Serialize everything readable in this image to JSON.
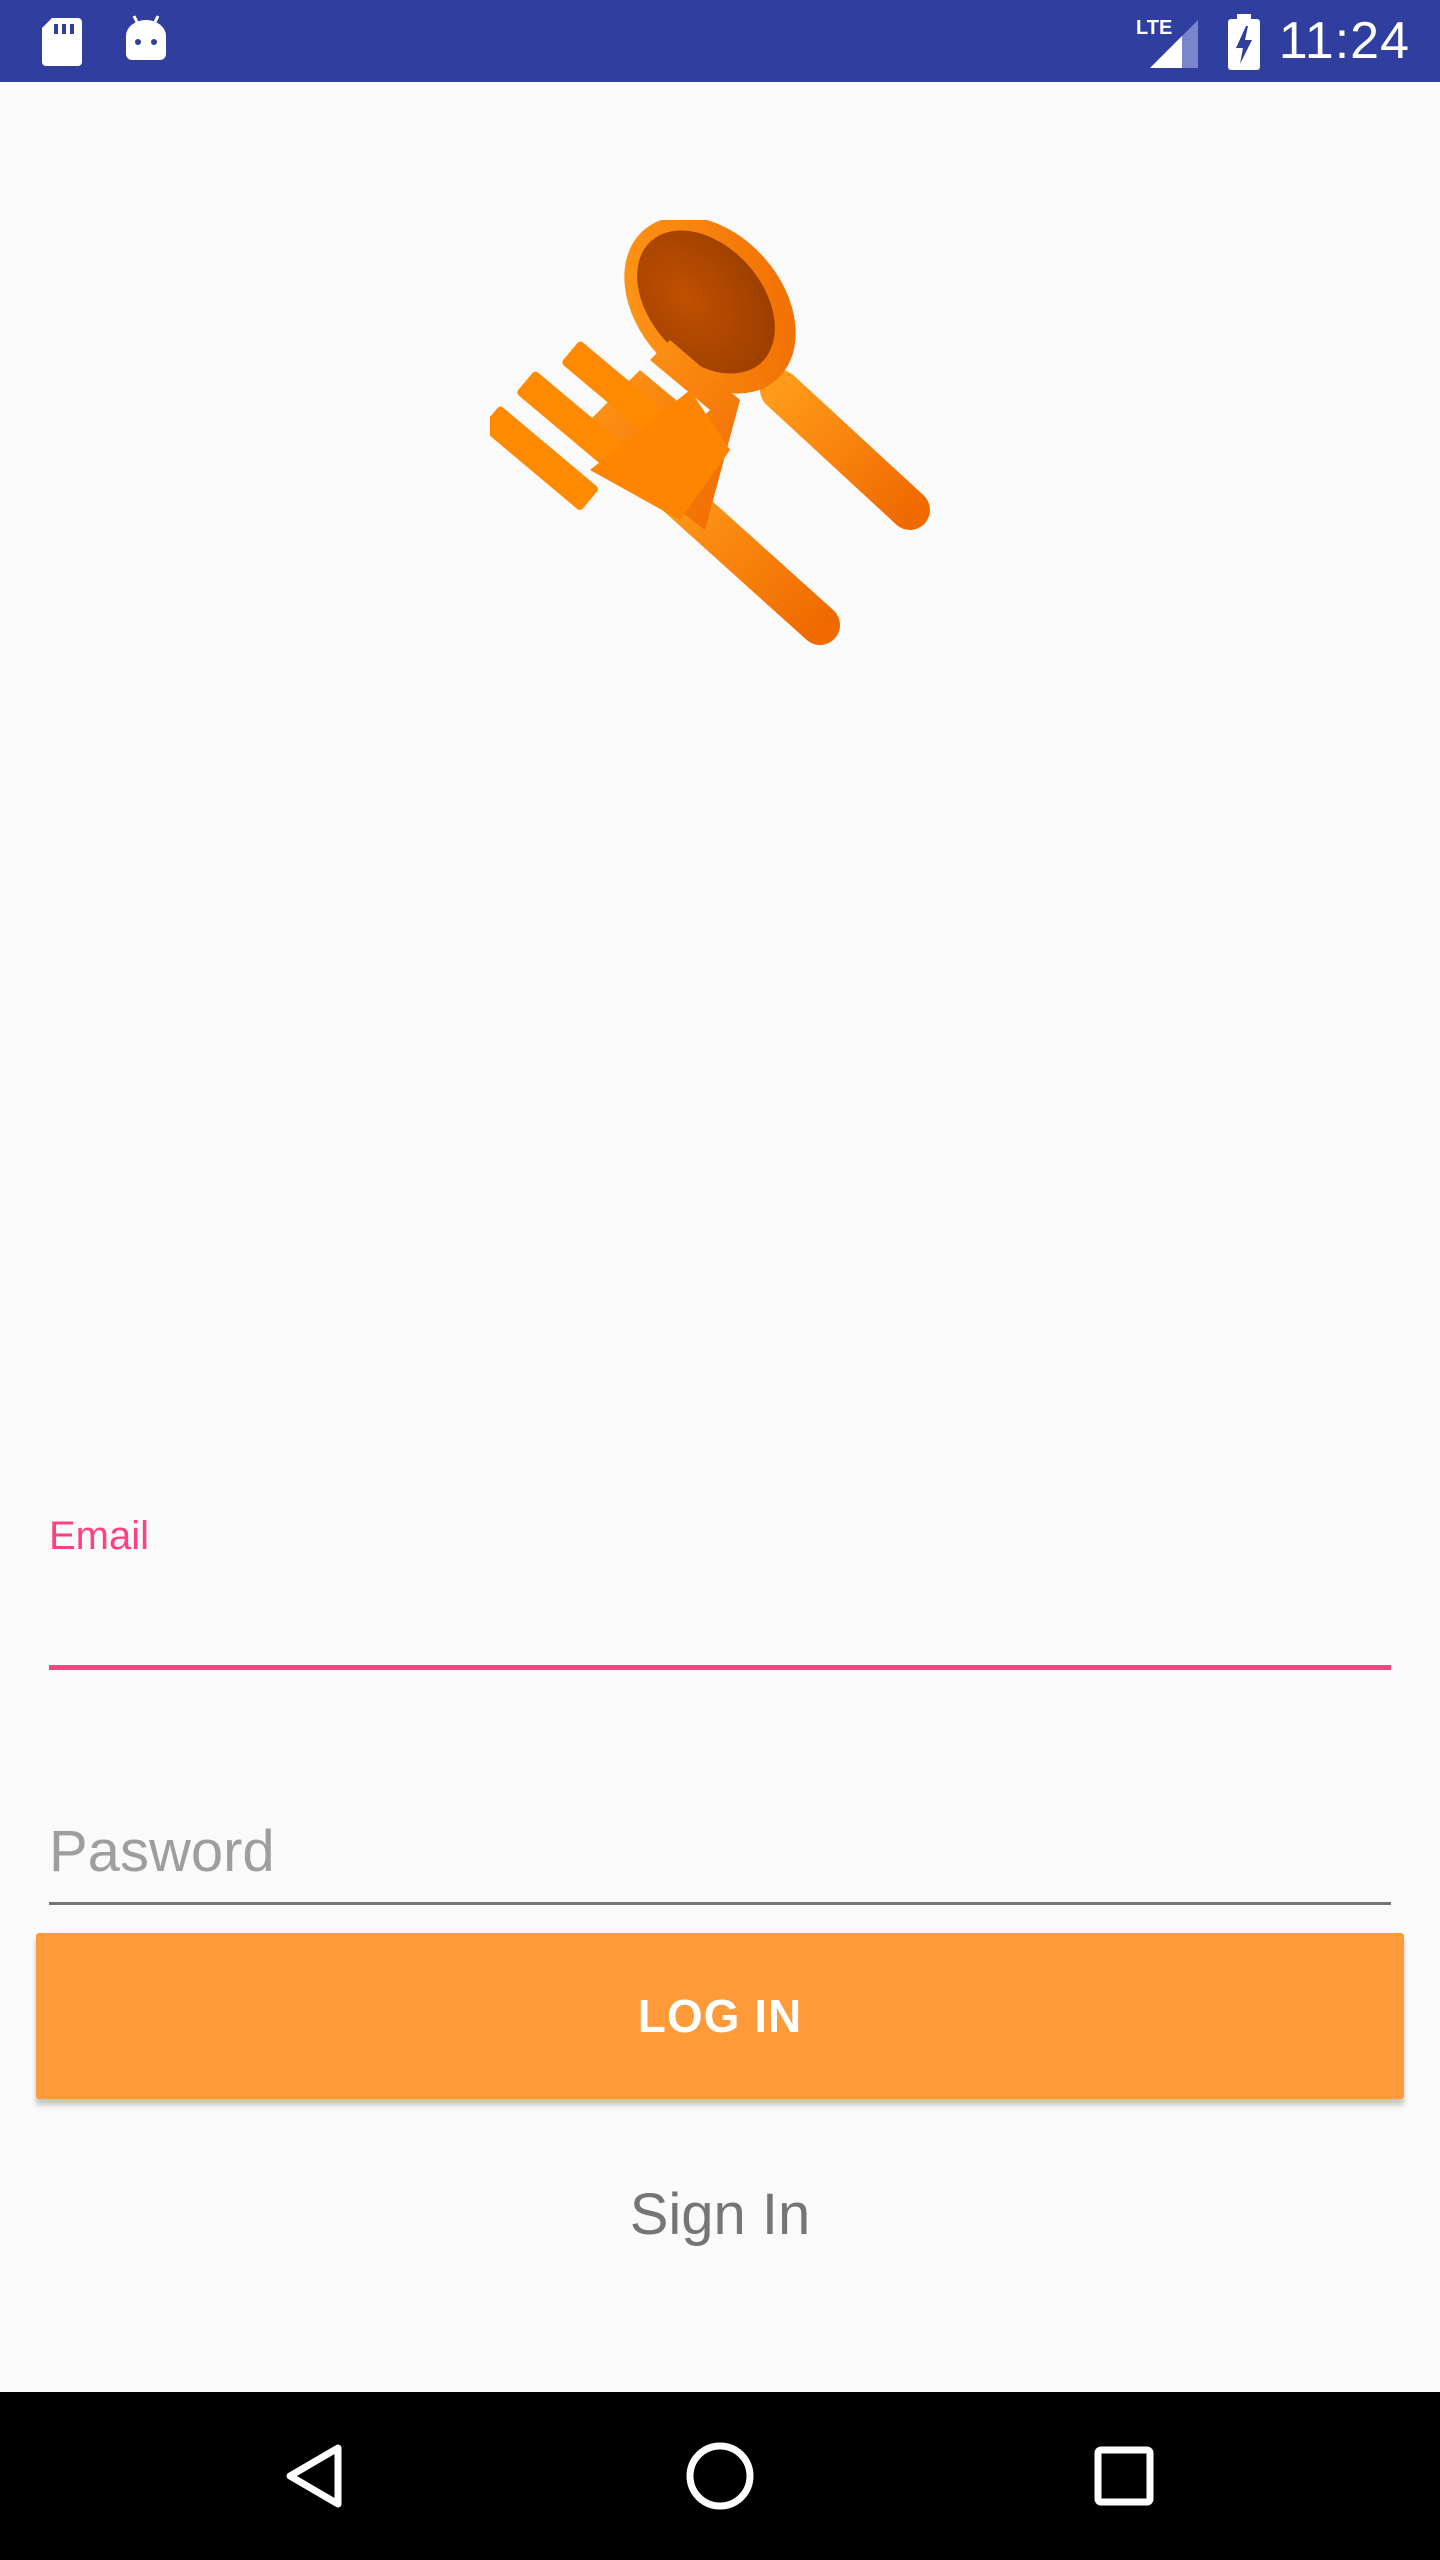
{
  "status_bar": {
    "time": "11:24",
    "network_label": "LTE",
    "icons": [
      "sd-card-icon",
      "android-icon",
      "lte-signal-icon",
      "battery-charging-icon"
    ],
    "background_color": "#303f9f"
  },
  "logo": {
    "icon": "fork-and-spoon-icon",
    "color": "#ff8000"
  },
  "login_form": {
    "email_label": "Email",
    "email_value": "",
    "password_placeholder": "Pasword",
    "password_value": "",
    "accent_color": "#ff4081"
  },
  "actions": {
    "login_label": "LOG IN",
    "login_color": "#fe9a37",
    "signin_label": "Sign In"
  },
  "nav_bar": {
    "buttons": [
      "back-icon",
      "home-icon",
      "recents-icon"
    ]
  }
}
